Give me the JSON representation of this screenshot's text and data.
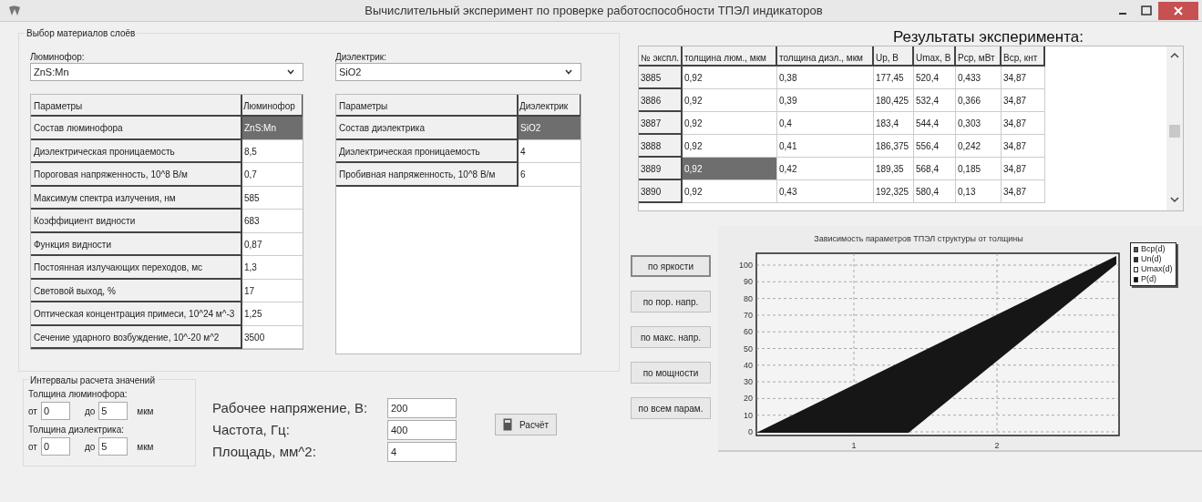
{
  "window": {
    "title": "Вычислительный эксперимент по проверке работоспособности ТПЭЛ индикаторов"
  },
  "materials": {
    "title": "Выбор материалов слоёв",
    "phosphor": {
      "label": "Люминофор:",
      "value": "ZnS:Mn"
    },
    "dielectric": {
      "label": "Диэлектрик:",
      "value": "SiO2"
    },
    "phosphor_table": {
      "columns": [
        "Параметры",
        "Люминофор"
      ],
      "rows": [
        {
          "param": "Состав люминофора",
          "value": "ZnS:Mn",
          "selected": true
        },
        {
          "param": "Диэлектрическая проницаемость",
          "value": "8,5",
          "selected": false
        },
        {
          "param": "Пороговая напряженность, 10^8 В/м",
          "value": "0,7",
          "selected": false
        },
        {
          "param": "Максимум спектра излучения, нм",
          "value": "585",
          "selected": false
        },
        {
          "param": "Коэффициент видности",
          "value": "683",
          "selected": false
        },
        {
          "param": "Функция видности",
          "value": "0,87",
          "selected": false
        },
        {
          "param": "Постоянная излучающих переходов, мс",
          "value": "1,3",
          "selected": false
        },
        {
          "param": "Световой выход, %",
          "value": "17",
          "selected": false
        },
        {
          "param": "Оптическая концентрация примеси, 10^24 м^-3",
          "value": "1,25",
          "selected": false
        },
        {
          "param": "Сечение ударного возбуждение, 10^-20 м^2",
          "value": "3500",
          "selected": false
        }
      ]
    },
    "dielectric_table": {
      "columns": [
        "Параметры",
        "Диэлектрик"
      ],
      "rows": [
        {
          "param": "Состав диэлектрика",
          "value": "SiO2",
          "selected": true
        },
        {
          "param": "Диэлектрическая проницаемость",
          "value": "4",
          "selected": false
        },
        {
          "param": "Пробивная напряженность, 10^8 В/м",
          "value": "6",
          "selected": false
        }
      ]
    }
  },
  "intervals": {
    "title": "Интервалы расчета значений",
    "groups": [
      {
        "label": "Толщина люминофора:",
        "from_label": "от",
        "from": "0",
        "to_label": "до",
        "to": "5",
        "unit": "мкм"
      },
      {
        "label": "Толщина диэлектрика:",
        "from_label": "от",
        "from": "0",
        "to_label": "до",
        "to": "5",
        "unit": "мкм"
      }
    ]
  },
  "params": [
    {
      "label": "Рабочее напряжение, В:",
      "value": "200"
    },
    {
      "label": "Частота, Гц:",
      "value": "400"
    },
    {
      "label": "Площадь, мм^2:",
      "value": "4"
    }
  ],
  "calc_button": "Расчёт",
  "results": {
    "title": "Результаты эксперимента:",
    "columns": [
      "№ экспл.",
      "толщина люм., мкм",
      "толщина диэл., мкм",
      "Up, В",
      "Umax, В",
      "Pср, мВт",
      "Bср, кнт"
    ],
    "rows": [
      {
        "cells": [
          {
            "text": "3885",
            "selected": false
          },
          {
            "text": "0,92",
            "selected": false
          },
          {
            "text": "0,38",
            "selected": false
          },
          {
            "text": "177,45",
            "selected": false
          },
          {
            "text": "520,4",
            "selected": false
          },
          {
            "text": "0,433",
            "selected": false
          },
          {
            "text": "34,87",
            "selected": false
          }
        ]
      },
      {
        "cells": [
          {
            "text": "3886",
            "selected": false
          },
          {
            "text": "0,92",
            "selected": false
          },
          {
            "text": "0,39",
            "selected": false
          },
          {
            "text": "180,425",
            "selected": false
          },
          {
            "text": "532,4",
            "selected": false
          },
          {
            "text": "0,366",
            "selected": false
          },
          {
            "text": "34,87",
            "selected": false
          }
        ]
      },
      {
        "cells": [
          {
            "text": "3887",
            "selected": false
          },
          {
            "text": "0,92",
            "selected": false
          },
          {
            "text": "0,4",
            "selected": false
          },
          {
            "text": "183,4",
            "selected": false
          },
          {
            "text": "544,4",
            "selected": false
          },
          {
            "text": "0,303",
            "selected": false
          },
          {
            "text": "34,87",
            "selected": false
          }
        ]
      },
      {
        "cells": [
          {
            "text": "3888",
            "selected": false
          },
          {
            "text": "0,92",
            "selected": false
          },
          {
            "text": "0,41",
            "selected": false
          },
          {
            "text": "186,375",
            "selected": false
          },
          {
            "text": "556,4",
            "selected": false
          },
          {
            "text": "0,242",
            "selected": false
          },
          {
            "text": "34,87",
            "selected": false
          }
        ]
      },
      {
        "cells": [
          {
            "text": "3889",
            "selected": false
          },
          {
            "text": "0,92",
            "selected": true
          },
          {
            "text": "0,42",
            "selected": false
          },
          {
            "text": "189,35",
            "selected": false
          },
          {
            "text": "568,4",
            "selected": false
          },
          {
            "text": "0,185",
            "selected": false
          },
          {
            "text": "34,87",
            "selected": false
          }
        ]
      },
      {
        "cells": [
          {
            "text": "3890",
            "selected": false
          },
          {
            "text": "0,92",
            "selected": false
          },
          {
            "text": "0,43",
            "selected": false
          },
          {
            "text": "192,325",
            "selected": false
          },
          {
            "text": "580,4",
            "selected": false
          },
          {
            "text": "0,13",
            "selected": false
          },
          {
            "text": "34,87",
            "selected": false
          }
        ]
      }
    ]
  },
  "chart_buttons": [
    {
      "label": "по яркости",
      "selected": true
    },
    {
      "label": "по пор. напр.",
      "selected": false
    },
    {
      "label": "по макс. напр.",
      "selected": false
    },
    {
      "label": "по мощности",
      "selected": false
    },
    {
      "label": "по всем парам.",
      "selected": false
    }
  ],
  "chart": {
    "title": "Зависимость параметров ТПЭЛ структуры от толщины",
    "y_labels": [
      "100",
      "90",
      "80",
      "70",
      "60",
      "50",
      "40",
      "30",
      "20",
      "10",
      "0"
    ],
    "x_labels": [
      "1",
      "2"
    ],
    "legend": [
      {
        "name": "Bср(d)",
        "color": "#555555"
      },
      {
        "name": "Un(d)",
        "color": "#333333"
      },
      {
        "name": "Umax(d)",
        "color": "#eeeeee"
      },
      {
        "name": "P(d)",
        "color": "#111111"
      }
    ]
  }
}
